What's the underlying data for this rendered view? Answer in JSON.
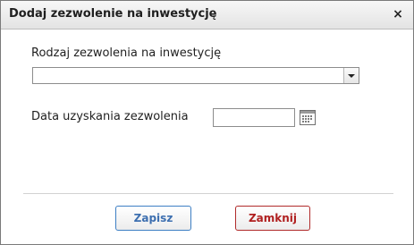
{
  "dialog": {
    "title": "Dodaj zezwolenie na inwestycję",
    "close_glyph": "×",
    "close_icon": "close-icon"
  },
  "form": {
    "type_label": "Rodzaj zezwolenia na inwestycję",
    "type_value": "",
    "date_label": "Data uzyskania zezwolenia",
    "date_value": "",
    "calendar_icon": "calendar-icon"
  },
  "buttons": {
    "save_label": "Zapisz",
    "close_label": "Zamknij",
    "save_color": "#3d7fc4",
    "close_color": "#b02a2a"
  }
}
